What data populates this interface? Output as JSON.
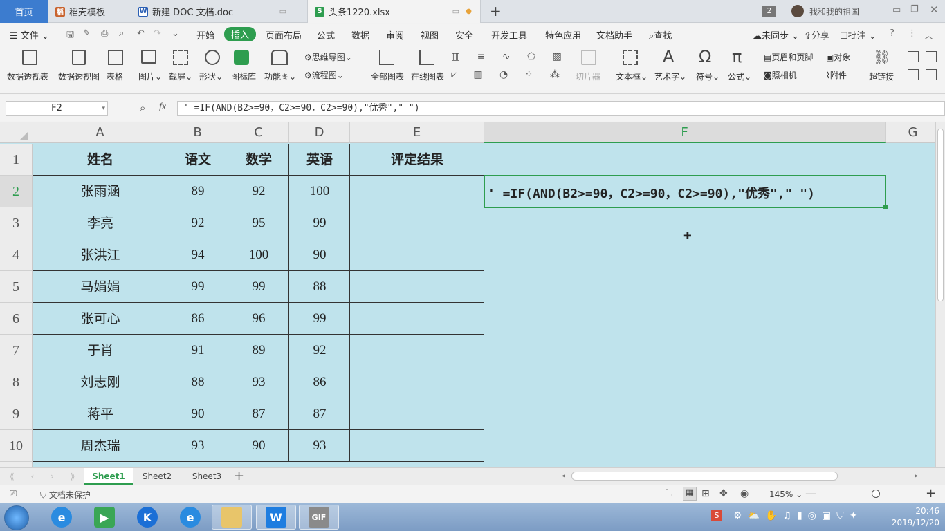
{
  "tabs": [
    {
      "label": "首页"
    },
    {
      "label": "稻壳模板"
    },
    {
      "label": "新建 DOC 文档.doc"
    },
    {
      "label": "头条1220.xlsx"
    }
  ],
  "window": {
    "badge": "2",
    "user": "我和我的祖国"
  },
  "menu": {
    "file": "文件",
    "items": [
      "开始",
      "插入",
      "页面布局",
      "公式",
      "数据",
      "审阅",
      "视图",
      "安全",
      "开发工具",
      "特色应用",
      "文档助手"
    ],
    "active": "插入",
    "search": "查找",
    "sync": "未同步",
    "share": "分享",
    "comment": "批注"
  },
  "ribbon": {
    "large": [
      "数据透视表",
      "数据透视图",
      "表格",
      "图片",
      "截屏",
      "形状",
      "图标库",
      "功能图",
      "全部图表",
      "在线图表",
      "切片器",
      "文本框",
      "艺术字",
      "符号",
      "公式",
      "超链接"
    ],
    "small": [
      "思维导图",
      "流程图",
      "页眉和页脚",
      "照相机",
      "对象",
      "附件"
    ]
  },
  "formula_bar": {
    "name_box": "F2",
    "fx": "fx",
    "formula": "' =IF(AND(B2>=90，C2>=90，C2>=90),\"优秀\",\" \")"
  },
  "columns": [
    "A",
    "B",
    "C",
    "D",
    "E",
    "F",
    "G"
  ],
  "rows": [
    "1",
    "2",
    "3",
    "4",
    "5",
    "6",
    "7",
    "8",
    "9",
    "10"
  ],
  "table": {
    "headers": [
      "姓名",
      "语文",
      "数学",
      "英语",
      "评定结果"
    ],
    "data": [
      [
        "张雨涵",
        "89",
        "92",
        "100",
        ""
      ],
      [
        "李亮",
        "92",
        "95",
        "99",
        ""
      ],
      [
        "张洪江",
        "94",
        "100",
        "90",
        ""
      ],
      [
        "马娟娟",
        "99",
        "99",
        "88",
        ""
      ],
      [
        "张可心",
        "86",
        "96",
        "99",
        ""
      ],
      [
        "于肖",
        "91",
        "89",
        "92",
        ""
      ],
      [
        "刘志刚",
        "88",
        "93",
        "86",
        ""
      ],
      [
        "蒋平",
        "90",
        "87",
        "87",
        ""
      ],
      [
        "周杰瑞",
        "93",
        "90",
        "93",
        ""
      ]
    ]
  },
  "cell_f2": "' =IF(AND(B2>=90，C2>=90，C2>=90),\"优秀\",\" \")",
  "sheets": [
    "Sheet1",
    "Sheet2",
    "Sheet3"
  ],
  "status": {
    "protect": "文档未保护",
    "zoom": "145%"
  },
  "clock": {
    "time": "20:46",
    "date": "2019/12/20"
  },
  "colors": {
    "accent": "#2e9d4f",
    "cell_fill": "#bfe3ec",
    "home_tab": "#3c7ccf"
  }
}
